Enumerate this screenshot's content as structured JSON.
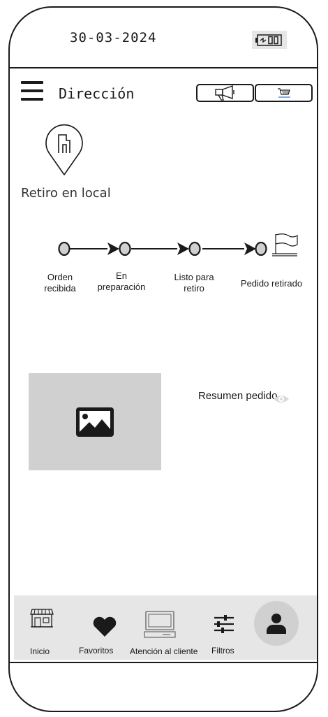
{
  "status_bar": {
    "date": "30-03-2024",
    "battery_icon": "battery-icon"
  },
  "header": {
    "menu_icon": "hamburger-menu-icon",
    "title": "Dirección",
    "buttons": [
      {
        "icon": "megaphone-icon"
      },
      {
        "icon": "cart-icon"
      }
    ]
  },
  "pickup": {
    "icon": "store-location-pin-icon",
    "label": "Retiro en local"
  },
  "progress": {
    "steps": [
      {
        "label_line1": "Orden",
        "label_line2": "recibida"
      },
      {
        "label_line1": "En",
        "label_line2": "preparación"
      },
      {
        "label_line1": "Listo para",
        "label_line2": "retiro"
      },
      {
        "label_line1": "Pedido retirado",
        "label_line2": ""
      }
    ],
    "final_icon": "flag-icon"
  },
  "summary": {
    "image_icon": "image-placeholder-icon",
    "label": "Resumen pedido",
    "toggle_icon": "eye-icon"
  },
  "bottom_nav": {
    "items": [
      {
        "label": "Inicio",
        "icon": "store-icon"
      },
      {
        "label": "Favoritos",
        "icon": "heart-icon"
      },
      {
        "label": "Atención al cliente",
        "icon": "computer-icon"
      },
      {
        "label": "Filtros",
        "icon": "sliders-icon"
      },
      {
        "label": "",
        "icon": "user-avatar-icon"
      }
    ]
  },
  "colors": {
    "ink": "#1a1a1a",
    "nav_bg": "#e6e6e6",
    "placeholder_bg": "#d0d0d0"
  }
}
